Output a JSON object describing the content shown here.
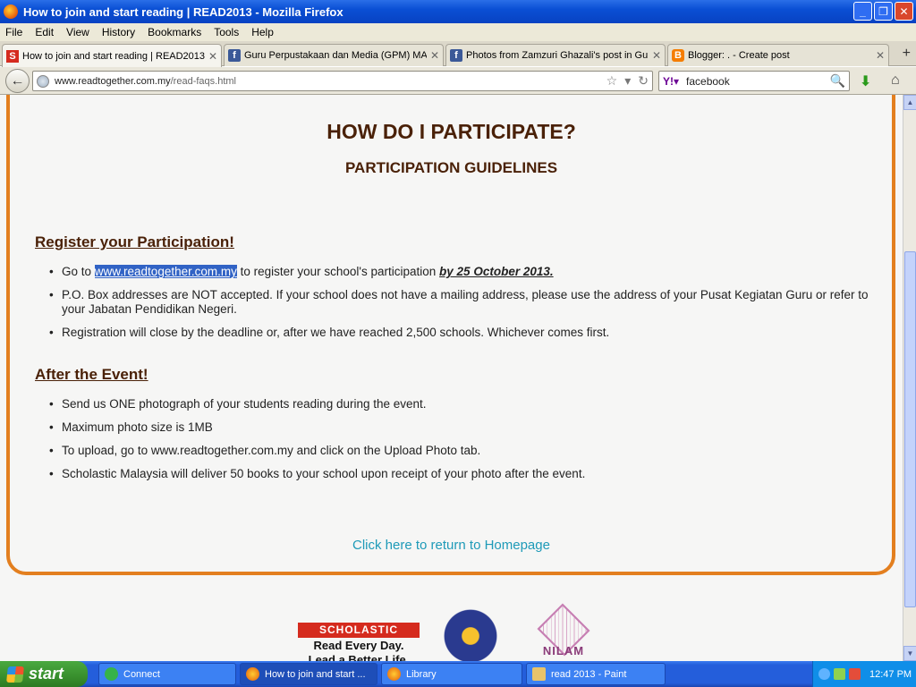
{
  "window": {
    "title": "How to join and start reading | READ2013 - Mozilla Firefox"
  },
  "menu": [
    "File",
    "Edit",
    "View",
    "History",
    "Bookmarks",
    "Tools",
    "Help"
  ],
  "tabs": [
    {
      "label": "How to join and start reading | READ2013",
      "icon": "scholastic-icon"
    },
    {
      "label": "Guru Perpustakaan dan Media (GPM) MA...",
      "icon": "facebook-icon"
    },
    {
      "label": "Photos from Zamzuri Ghazali's post in Gur...",
      "icon": "facebook-icon"
    },
    {
      "label": "Blogger: . - Create post",
      "icon": "blogger-icon"
    }
  ],
  "nav": {
    "url_domain": "www.readtogether.com.my",
    "url_path": "/read-faqs.html",
    "search_value": "facebook"
  },
  "page": {
    "heading": "HOW DO I PARTICIPATE?",
    "subheading": "PARTICIPATION GUIDELINES",
    "register": {
      "title": "Register your Participation!",
      "b1_prefix": "Go to ",
      "b1_link": "www.readtogether.com.my",
      "b1_mid": " to register your school's participation ",
      "b1_deadline": "by 25 October 2013.",
      "b2": "P.O. Box addresses are NOT accepted. If your school does not have a mailing address, please use the address of your Pusat Kegiatan Guru or refer to your Jabatan Pendidikan Negeri.",
      "b3": "Registration will close by the deadline or, after we have reached 2,500 schools. Whichever comes first."
    },
    "after": {
      "title": "After the Event!",
      "items": [
        "Send us ONE photograph of your students reading during the event.",
        "Maximum photo size is 1MB",
        "To upload, go to www.readtogether.com.my and click on the Upload Photo tab.",
        "Scholastic Malaysia will deliver 50 books to your school upon receipt of your photo after the event."
      ]
    },
    "home_link": "Click here to return to Homepage",
    "logos": {
      "scholastic": "SCHOLASTIC",
      "scholastic_tagline_1": "Read Every Day.",
      "scholastic_tagline_2": "Lead a Better Life.",
      "nilam": "NILAM"
    }
  },
  "taskbar": {
    "start": "start",
    "tasks": [
      "Connect",
      "How to join and start ...",
      "Library",
      "read 2013 - Paint"
    ],
    "clock": "12:47 PM"
  },
  "colors": {
    "accent_orange": "#e37f1f",
    "heading_brown": "#4a2108",
    "link_teal": "#1e9ab8"
  }
}
